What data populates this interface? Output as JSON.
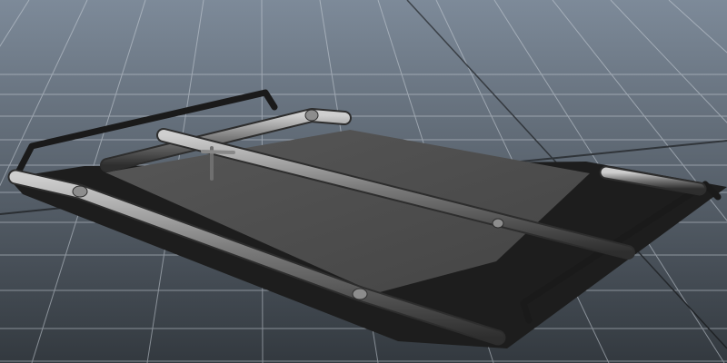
{
  "viewport": {
    "background_top": "#7d8a99",
    "background_bottom": "#33393f",
    "grid_color": "#c9d0d8",
    "grid_axis_color": "#0b0b0b",
    "object_dark": "#1d1d1d",
    "object_panel": "#4e4e4e",
    "tube_color": "#7b7b7b",
    "tube_highlight": "#b7b7b7",
    "tube_shadow": "#2e2e2e"
  },
  "scene": {
    "object_name": "roof-rack-model",
    "icons": [
      "grid-floor",
      "tube-rail",
      "mesh-plate"
    ]
  }
}
